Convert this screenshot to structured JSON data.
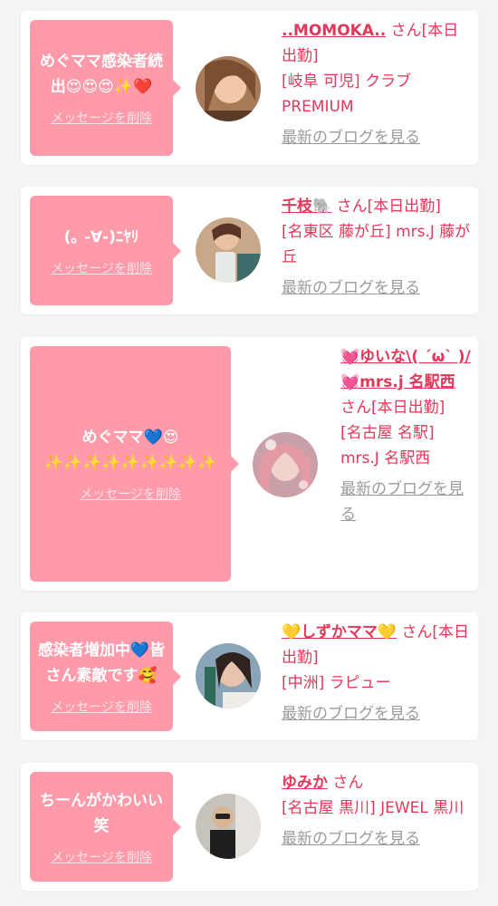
{
  "delete_label": "メッセージを削除",
  "blog_label": "最新のブログを見る",
  "colors": {
    "accent": "#e3385a",
    "bubble": "#fe9aa9",
    "background": "#f4f4f4"
  },
  "cards": [
    {
      "message": "めぐママ感染者続出😍😍😍✨❤️",
      "name": "..MOMOKA..",
      "status": "さん[本日出勤]",
      "shop": "[岐阜 可児] クラブPREMIUM"
    },
    {
      "message": "(｡ -∀-)ﾆﾔﾘ",
      "name": "千枝🐘",
      "status": "さん[本日出勤]",
      "shop": "[名東区 藤が丘] mrs.J 藤が丘"
    },
    {
      "message": "めぐママ💙😍 ✨✨✨✨✨✨✨✨✨",
      "name": "💓ゆいな\\( ´ω` )/💓mrs.j 名駅西",
      "status": "さん[本日出勤]",
      "shop": "[名古屋 名駅] mrs.J 名駅西"
    },
    {
      "message": "感染者増加中💙皆さん素敵です🥰",
      "name": "💛しずかママ💛",
      "status": "さん[本日出勤]",
      "shop": "[中洲] ラピュー"
    },
    {
      "message": "ちーんがかわいい笑",
      "name": "ゆみか",
      "status": "さん",
      "shop": "[名古屋 黒川] JEWEL 黒川"
    }
  ]
}
